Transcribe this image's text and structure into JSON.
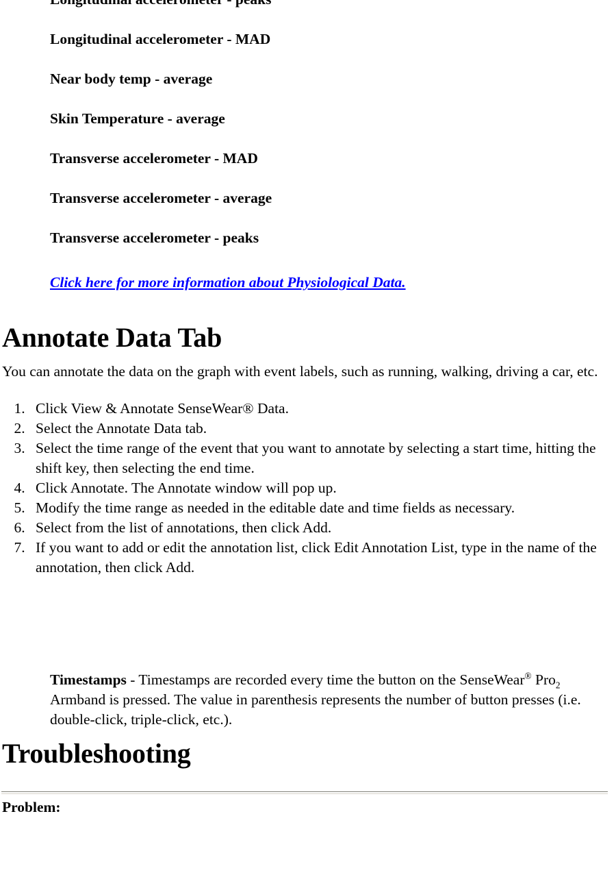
{
  "document": {
    "measures": [
      "Longitudinal accelerometer - peaks",
      "Longitudinal accelerometer - MAD",
      "Near body temp - average",
      "Skin Temperature - average",
      "Transverse accelerometer - MAD",
      "Transverse accelerometer - average",
      "Transverse accelerometer - peaks"
    ],
    "more_info_link": {
      "text": "Click here for more information about Physiological Data.",
      "color": "#0000ff"
    },
    "annotate_section": {
      "heading": "Annotate Data Tab",
      "intro": "You can annotate the data on the graph with event labels, such as running, walking, driving a car, etc.",
      "steps": [
        "Click View & Annotate SenseWear® Data.",
        "Select the Annotate Data tab.",
        "Select the time range of the event that you want to annotate by selecting a start time, hitting the shift key, then selecting the end time.",
        "Click Annotate. The Annotate window will pop up.",
        "Modify the time range as needed in the editable date and time fields as necessary.",
        "Select from the list of annotations, then click Add.",
        "If you want to add or edit the annotation list, click Edit Annotation List, type in the name of the annotation, then click Add."
      ]
    },
    "timestamps_definition": {
      "term": "Timestamps",
      "separator": " - ",
      "body_part1": "Timestamps are recorded every time the button on the SenseWear",
      "superscript1": "®",
      "body_part2": " Pro",
      "subscript1": "2",
      "body_part3": " Armband is pressed. The value in parenthesis represents the number of button presses (i.e. double-click, triple-click, etc.)."
    },
    "troubleshooting_section": {
      "heading": "Troubleshooting",
      "problem_label": "Problem:"
    }
  }
}
